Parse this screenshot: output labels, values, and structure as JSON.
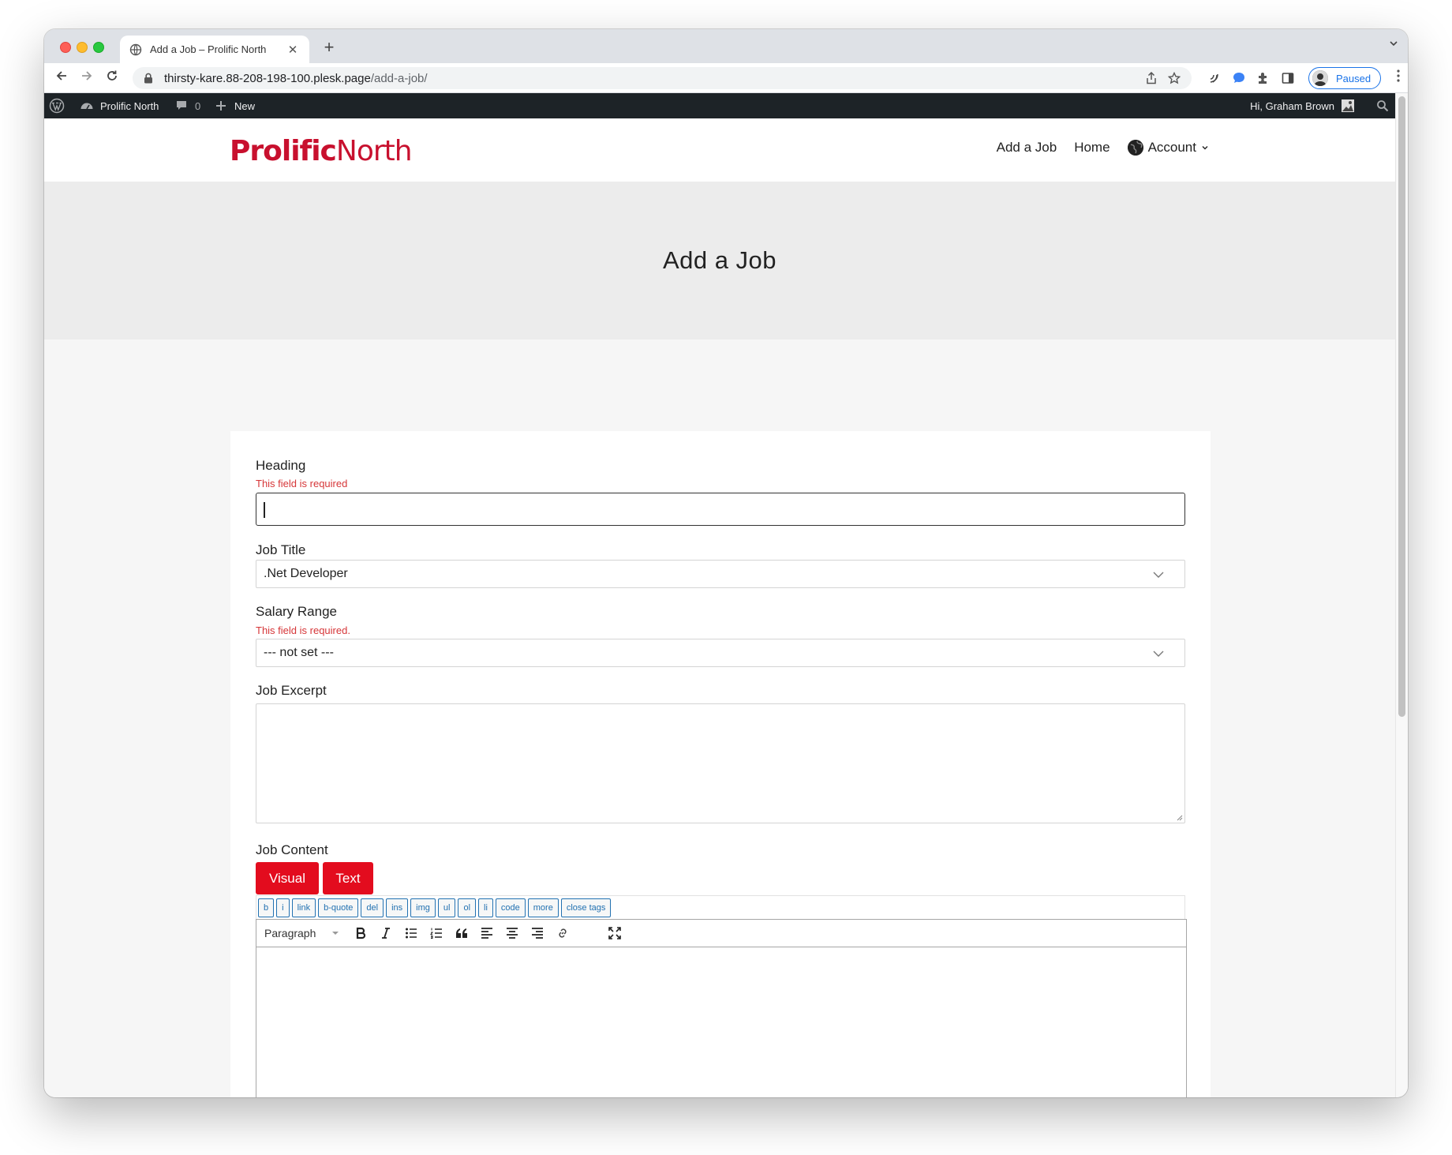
{
  "browser": {
    "tab_title": "Add a Job – Prolific North",
    "tab_close": "✕",
    "new_tab": "+",
    "url_host": "thirsty-kare.88-208-198-100.plesk.page",
    "url_path": "/add-a-job/",
    "profile_status": "Paused",
    "accent_color": "#1a73e8"
  },
  "adminbar": {
    "site_name": "Prolific North",
    "comments_count": "0",
    "new_label": "New",
    "greeting": "Hi, Graham Brown"
  },
  "site": {
    "logo_bold": "Prolific",
    "logo_light": "North",
    "brand_color": "#c8102e",
    "nav": {
      "add_job": "Add a Job",
      "home": "Home",
      "account": "Account"
    }
  },
  "hero": {
    "title": "Add a Job"
  },
  "form": {
    "heading": {
      "label": "Heading",
      "error": "This field is required",
      "value": ""
    },
    "job_title": {
      "label": "Job Title",
      "selected": ".Net Developer"
    },
    "salary_range": {
      "label": "Salary Range",
      "error": "This field is required.",
      "selected": "--- not set ---"
    },
    "job_excerpt": {
      "label": "Job Excerpt",
      "value": ""
    },
    "job_content": {
      "label": "Job Content",
      "visual_tab": "Visual",
      "text_tab": "Text",
      "button_color": "#e30c1e",
      "quicktags": [
        "b",
        "i",
        "link",
        "b-quote",
        "del",
        "ins",
        "img",
        "ul",
        "ol",
        "li",
        "code",
        "more",
        "close tags"
      ],
      "format_select": "Paragraph",
      "toolbar_icons": [
        "bold-icon",
        "italic-icon",
        "bullet-list-icon",
        "numbered-list-icon",
        "blockquote-icon",
        "align-left-icon",
        "align-center-icon",
        "align-right-icon",
        "link-icon",
        "fullscreen-icon"
      ]
    }
  }
}
